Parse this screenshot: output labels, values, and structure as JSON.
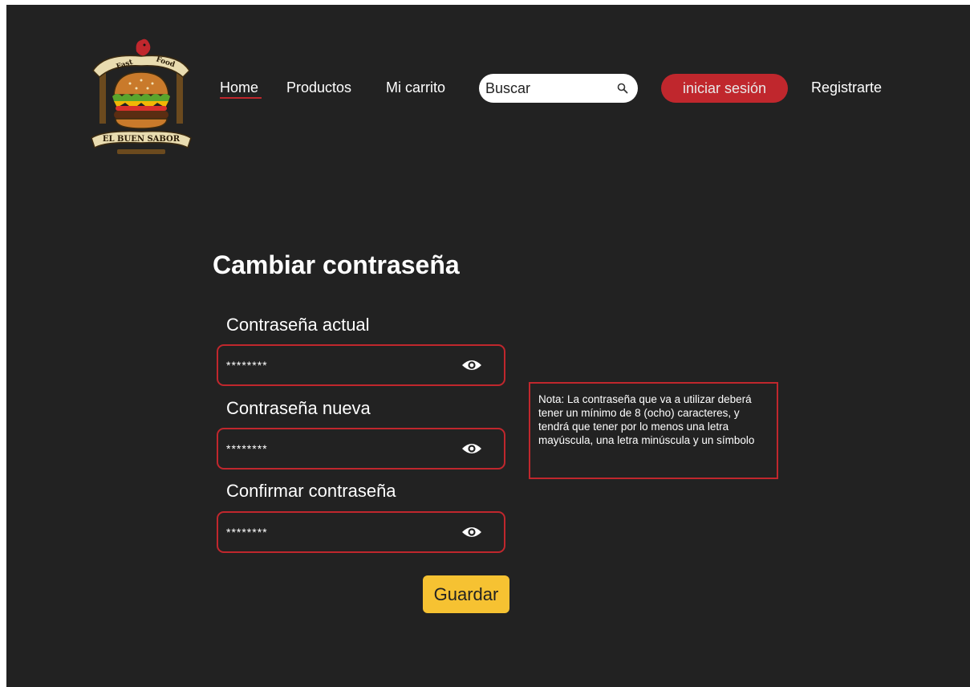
{
  "brand": {
    "logo_text_top_left": "Fast",
    "logo_text_top_right": "Food",
    "logo_text_banner": "EL BUEN SABOR"
  },
  "nav": {
    "home": "Home",
    "products": "Productos",
    "cart": "Mi carrito",
    "search_placeholder": "Buscar",
    "login": "iniciar sesión",
    "register": "Registrarte"
  },
  "form": {
    "title": "Cambiar contraseña",
    "fields": [
      {
        "label": "Contraseña actual",
        "value": "********"
      },
      {
        "label": "Contraseña nueva",
        "value": "********"
      },
      {
        "label": "Confirmar contraseña",
        "value": "********"
      }
    ],
    "note": "Nota: La contraseña que va a utilizar deberá tener un mínimo de 8 (ocho) caracteres, y tendrá que tener por lo menos una letra mayúscula, una letra minúscula y un símbolo",
    "save_label": "Guardar"
  },
  "colors": {
    "background": "#222222",
    "accent_red": "#c0272d",
    "save_yellow": "#f6c232"
  }
}
